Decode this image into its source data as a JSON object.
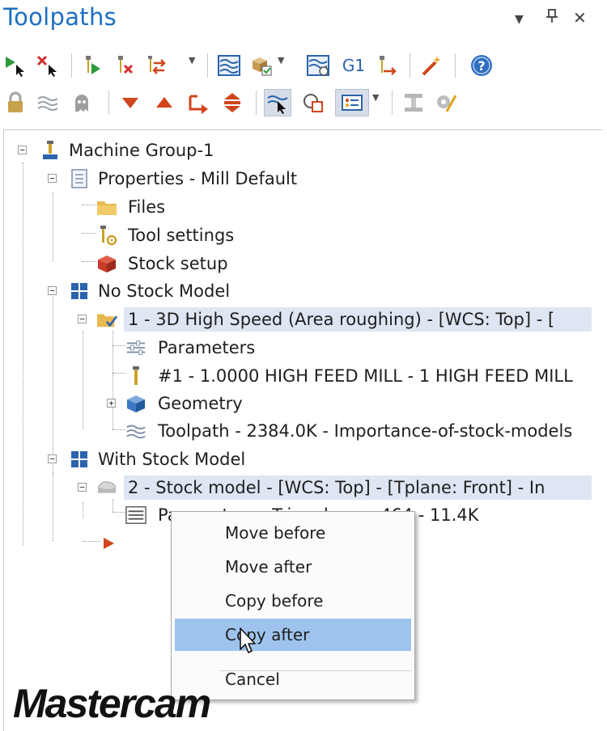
{
  "panel": {
    "title": "Toolpaths",
    "controls": {
      "menu_glyph": "▼",
      "pin_glyph": "⊥",
      "close_glyph": "✕"
    }
  },
  "toolbar_row1": [
    {
      "name": "select-all-operations-icon"
    },
    {
      "name": "deselect-all-icon"
    },
    {
      "name": "regenerate-selected-icon"
    },
    {
      "name": "regenerate-dirty-icon"
    },
    {
      "name": "toggle-operations-icon"
    },
    {
      "name": "simulate-backplot-icon"
    },
    {
      "name": "verify-selected-icon"
    },
    {
      "name": "simulator-icon"
    },
    {
      "name": "post-selected-icon",
      "text": "G1"
    },
    {
      "name": "high-feed-icon"
    },
    {
      "name": "magic-wand-icon"
    },
    {
      "name": "help-icon",
      "text": "?"
    }
  ],
  "toolbar_row2": [
    {
      "name": "lock-icon"
    },
    {
      "name": "toggle-toolpath-display-icon"
    },
    {
      "name": "ghost-icon"
    },
    {
      "name": "move-down-icon"
    },
    {
      "name": "move-up-icon"
    },
    {
      "name": "insert-arrow-icon"
    },
    {
      "name": "scroll-toggle-icon"
    },
    {
      "name": "select-toolpath-icon"
    },
    {
      "name": "select-geometry-icon"
    },
    {
      "name": "display-options-icon"
    },
    {
      "name": "machine-sim-icon"
    },
    {
      "name": "settings-icon"
    }
  ],
  "tree": {
    "machine_group": "Machine Group-1",
    "properties": "Properties - Mill Default",
    "files": "Files",
    "tool_settings": "Tool settings",
    "stock_setup": "Stock setup",
    "no_stock_model": "No Stock Model",
    "op1": "1 - 3D High Speed (Area roughing) - [WCS: Top] - [",
    "op1_parameters": "Parameters",
    "op1_tool": "#1 - 1.0000 HIGH FEED MILL - 1 HIGH FEED MILL",
    "op1_geometry": "Geometry",
    "op1_toolpath": "Toolpath - 2384.0K - Importance-of-stock-models",
    "with_stock_model": "With Stock Model",
    "op2": "2 - Stock model - [WCS: Top] - [Tplane: Front] - In",
    "op2_parameters": "Parameters - Triangles: ... 464 - 11.4K"
  },
  "context_menu": {
    "items": [
      "Move before",
      "Move after",
      "Copy before",
      "Copy after"
    ],
    "cancel": "Cancel",
    "hovered": "Copy after"
  },
  "brand": "Mastercam",
  "colors": {
    "title": "#1c6fc0",
    "selection": "#dfe6f3",
    "menu_hover": "#9ec4ee",
    "folder": "#e8b94f",
    "stock": "#c83a2a",
    "geometry": "#3a78c4",
    "insert_arrow": "#d0451b"
  }
}
